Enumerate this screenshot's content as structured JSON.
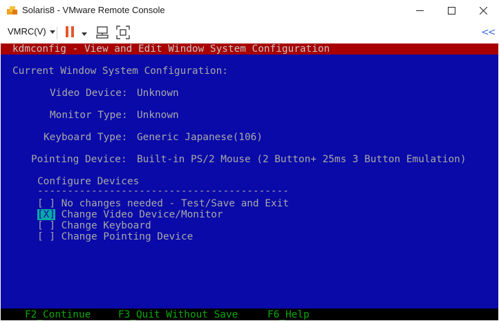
{
  "window": {
    "title": "Solaris8 - VMware Remote Console",
    "min_glyph": "—",
    "max_glyph": "☐",
    "close_glyph": "✕"
  },
  "toolbar": {
    "vmrc_menu": "VMRC(V)",
    "collapse_glyph": "<<",
    "pause_color": "#e3572b"
  },
  "console": {
    "header": "kdmconfig - View and Edit Window System Configuration",
    "current_config_title": "Current Window System Configuration:",
    "fields": [
      {
        "label": "Video Device:",
        "value": "Unknown"
      },
      {
        "label": "Monitor Type:",
        "value": "Unknown"
      },
      {
        "label": "Keyboard Type:",
        "value": "Generic Japanese(106)"
      },
      {
        "label": "Pointing Device:",
        "value": "Built-in PS/2 Mouse (2 Button+ 25ms 3 Button Emulation)"
      }
    ],
    "configure_title": "Configure Devices",
    "divider": "------------------------------------------",
    "options": [
      {
        "mark": "[ ]",
        "label": "No changes needed - Test/Save and Exit"
      },
      {
        "mark": "[X]",
        "label": "Change Video Device/Monitor"
      },
      {
        "mark": "[ ]",
        "label": "Change Keyboard"
      },
      {
        "mark": "[ ]",
        "label": "Change Pointing Device"
      }
    ],
    "function_keys": [
      "F2_Continue",
      "F3_Quit Without Save",
      "F6_Help"
    ],
    "colors": {
      "background": "#0a0aa8",
      "header_bar": "#a80000",
      "text": "#a8a8a8",
      "highlight": "#08a8a8",
      "function_keys": "#0aa80a"
    }
  }
}
